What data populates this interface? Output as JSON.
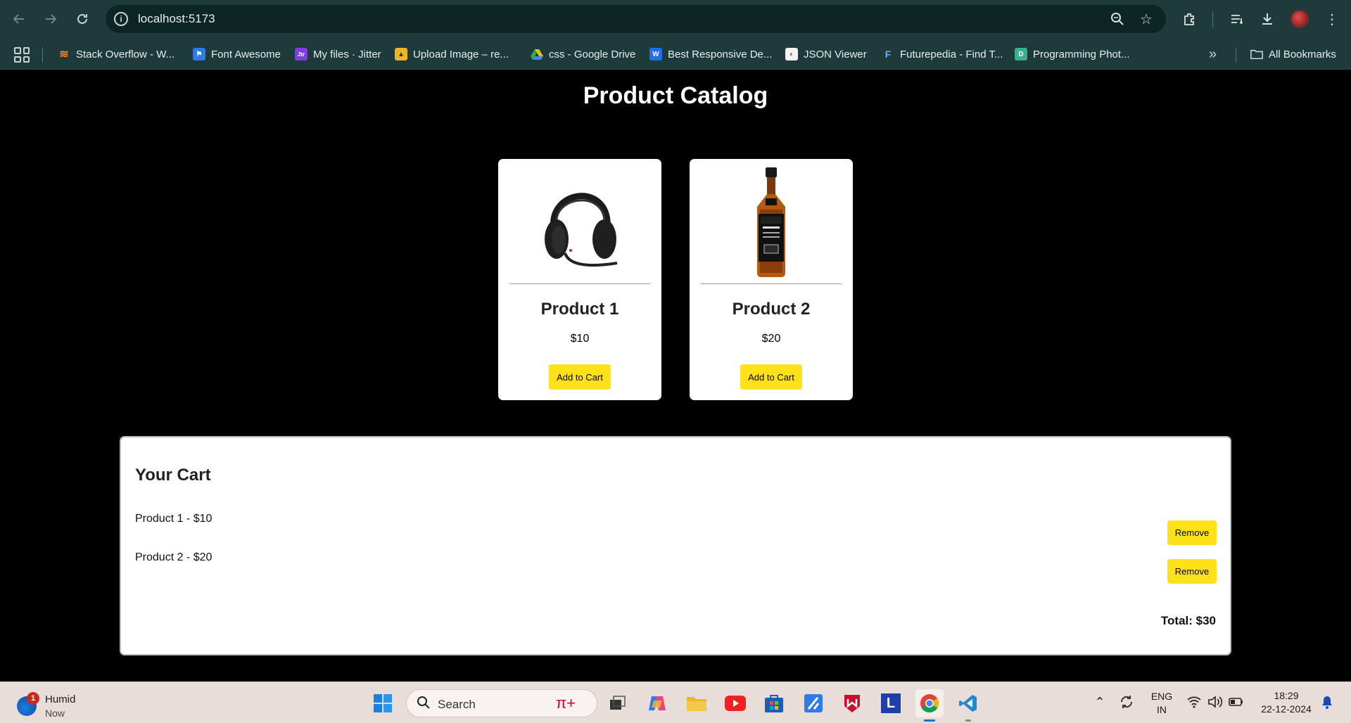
{
  "browser": {
    "url": "localhost:5173",
    "bookmarks": [
      {
        "label": "Stack Overflow - W...",
        "icon": "stackoverflow-icon",
        "color": "#f48024"
      },
      {
        "label": "Font Awesome",
        "icon": "flag-icon",
        "color": "#2d7be5"
      },
      {
        "label": "My files · Jitter",
        "icon": "jitter-icon",
        "color": "#7b3fe4"
      },
      {
        "label": "Upload Image – re...",
        "icon": "upload-icon",
        "color": "#f0b429"
      },
      {
        "label": "css - Google Drive",
        "icon": "google-drive-icon",
        "color": "#34a853"
      },
      {
        "label": "Best Responsive De...",
        "icon": "w-icon",
        "color": "#1f6feb"
      },
      {
        "label": "JSON Viewer",
        "icon": "json-viewer-icon",
        "color": "#e04040"
      },
      {
        "label": "Futurepedia - Find T...",
        "icon": "futurepedia-icon",
        "color": "#1a4aa8"
      },
      {
        "label": "Programming Phot...",
        "icon": "d-icon",
        "color": "#3bb08f"
      }
    ],
    "all_bookmarks": "All Bookmarks"
  },
  "page": {
    "title": "Product Catalog",
    "products": [
      {
        "name": "Product 1",
        "price": "$10",
        "button": "Add to Cart",
        "image": "headphones-icon"
      },
      {
        "name": "Product 2",
        "price": "$20",
        "button": "Add to Cart",
        "image": "whiskey-bottle-icon"
      }
    ],
    "cart": {
      "title": "Your Cart",
      "items": [
        {
          "text": "Product 1 - $10",
          "button": "Remove"
        },
        {
          "text": "Product 2 - $20",
          "button": "Remove"
        }
      ],
      "total": "Total: $30"
    },
    "accent": "#ffe11a"
  },
  "taskbar": {
    "weather_name": "Humid",
    "weather_time": "Now",
    "weather_badge": "1",
    "search_placeholder": "Search",
    "lang": "ENG",
    "region": "IN",
    "time": "18:29",
    "date": "22-12-2024"
  }
}
